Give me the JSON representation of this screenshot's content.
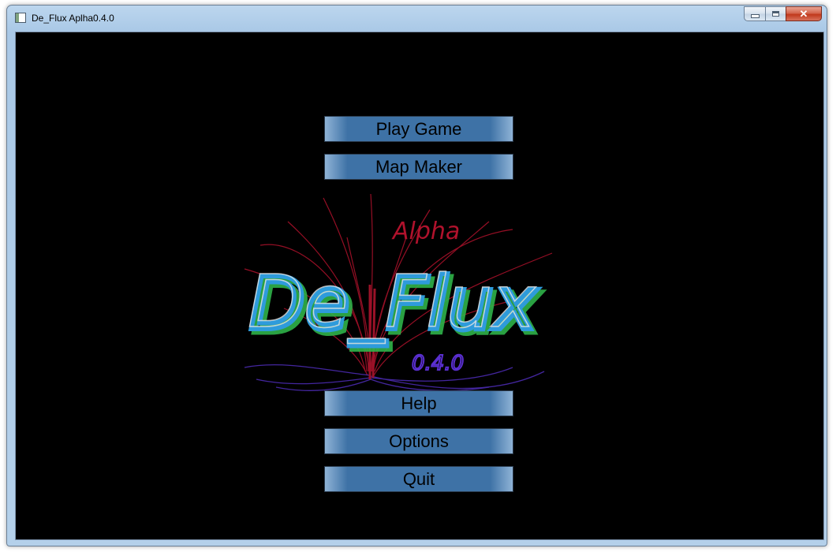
{
  "window": {
    "title": "De_Flux Aplha0.4.0",
    "controls": {
      "minimize": "minimize",
      "maximize": "maximize",
      "close": "✕"
    }
  },
  "logo": {
    "name": "De_Flux",
    "tag": "Alpha",
    "version": "0.4.0",
    "colors": {
      "main_blue": "#2e9bdb",
      "main_green": "#2fb34a",
      "roots_red": "#b0122c",
      "roots_purple": "#4b2bb0",
      "version_purple": "#5a2fd0",
      "highlight": "#e6e6e6"
    }
  },
  "menu": {
    "items": [
      {
        "label": "Play Game"
      },
      {
        "label": "Map Maker"
      },
      {
        "label": "Help"
      },
      {
        "label": "Options"
      },
      {
        "label": "Quit"
      }
    ]
  }
}
